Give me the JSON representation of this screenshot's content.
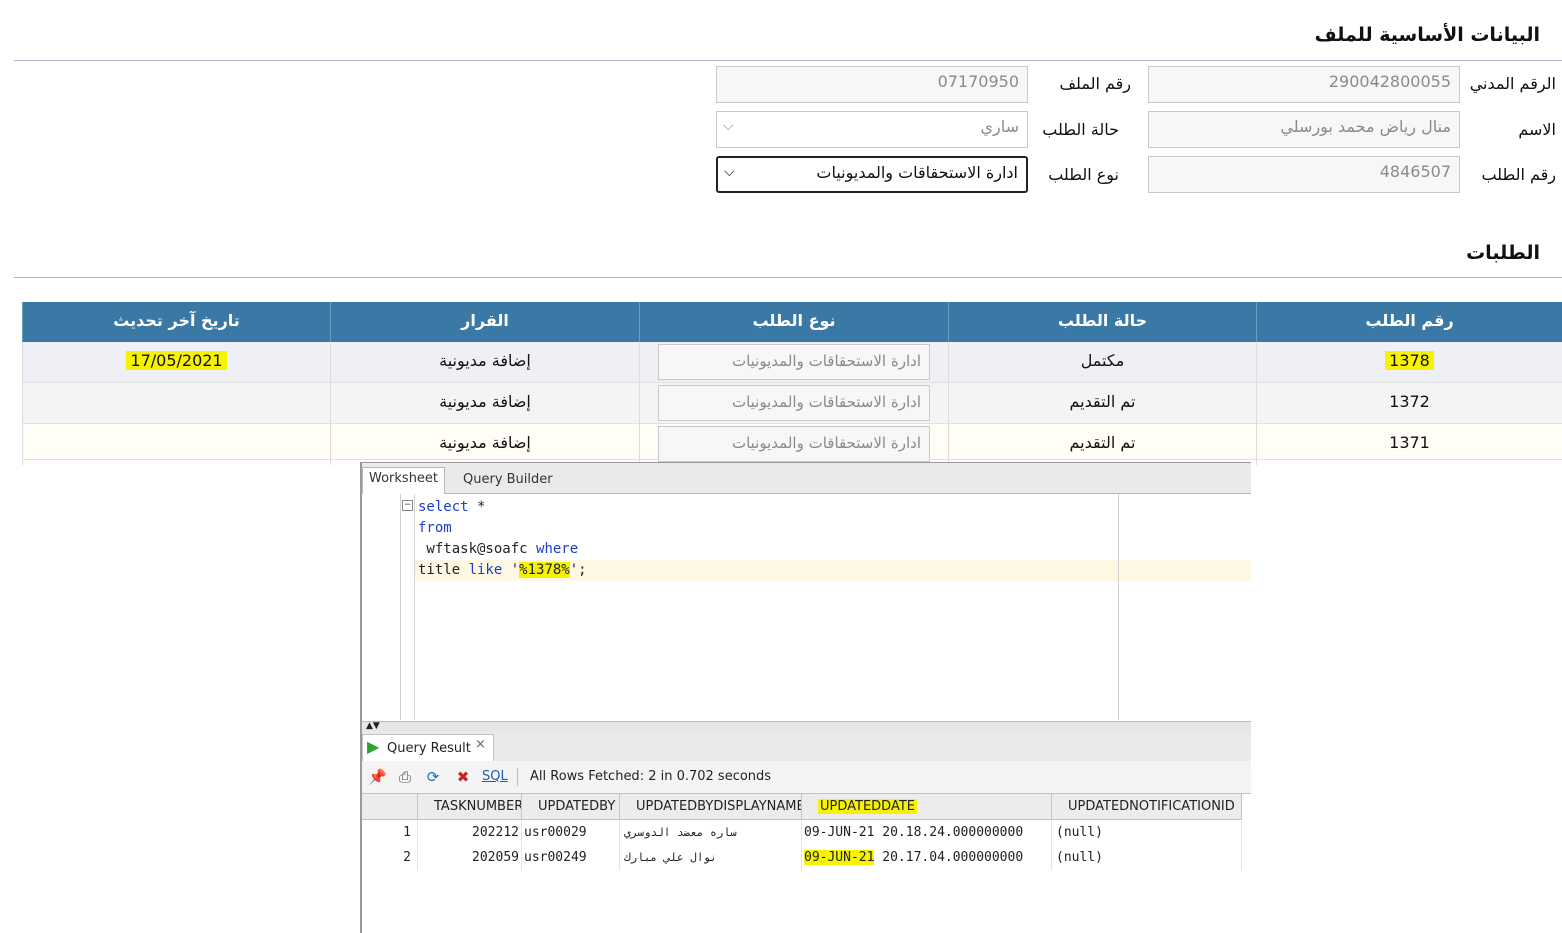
{
  "basic_info": {
    "title": "البيانات الأساسية للملف",
    "civil_id_label": "الرقم المدني",
    "civil_id_value": "290042800055",
    "name_label": "الاسم",
    "name_value": "منال رياض محمد بورسلي",
    "request_no_label": "رقم الطلب",
    "request_no_value": "4846507",
    "file_no_label": "رقم الملف",
    "file_no_value": "07170950",
    "request_status_label": "حالة الطلب",
    "request_status_value": "ساري",
    "request_type_label": "نوع الطلب",
    "request_type_value": "ادارة الاستحقاقات والمديونيات"
  },
  "requests": {
    "title": "الطلبات",
    "headers": [
      "رقم الطلب",
      "حالة الطلب",
      "نوع الطلب",
      "القرار",
      "تاريخ آخر تحديث"
    ],
    "rows": [
      {
        "number": "1378",
        "status": "مكتمل",
        "type": "ادارة الاستحقاقات والمديونيات",
        "decision": "إضافة مديونية",
        "updated": "17/05/2021"
      },
      {
        "number": "1372",
        "status": "تم التقديم",
        "type": "ادارة الاستحقاقات والمديونيات",
        "decision": "إضافة مديونية",
        "updated": ""
      },
      {
        "number": "1371",
        "status": "تم التقديم",
        "type": "ادارة الاستحقاقات والمديونيات",
        "decision": "إضافة مديونية",
        "updated": ""
      }
    ]
  },
  "sql_developer": {
    "tabs": [
      "Worksheet",
      "Query Builder"
    ],
    "code": {
      "line1_kw": "select",
      "line1_rest": " *",
      "line2_kw": "from",
      "line3_a": " wftask@soafc ",
      "line3_kw": "where",
      "line4_a": "title ",
      "line4_kw": "like",
      "line4_b": " '",
      "line4_hl": "%1378%",
      "line4_c": "';"
    },
    "result_tab": "Query Result",
    "result_close": "×",
    "toolbar_sql": "SQL",
    "status": "All Rows Fetched: 2 in 0.702 seconds",
    "columns": [
      "TASKNUMBER",
      "UPDATEDBY",
      "UPDATEDBYDISPLAYNAME",
      "UPDATEDDATE",
      "UPDATEDNOTIFICATIONID"
    ],
    "rows": [
      {
        "n": "1",
        "tasknumber": "202212",
        "updatedby": "usr00029",
        "displayname": "ساره معضد الدوسري",
        "date": "09-JUN-21",
        "time": "20.18.24.000000000",
        "notif": "(null)"
      },
      {
        "n": "2",
        "tasknumber": "202059",
        "updatedby": "usr00249",
        "displayname": "نوال علي مبارك",
        "date": "09-JUN-21",
        "time": "20.17.04.000000000",
        "notif": "(null)"
      }
    ],
    "colors": {
      "keyword": "#1a3fcf",
      "highlight": "#f6f200"
    }
  }
}
